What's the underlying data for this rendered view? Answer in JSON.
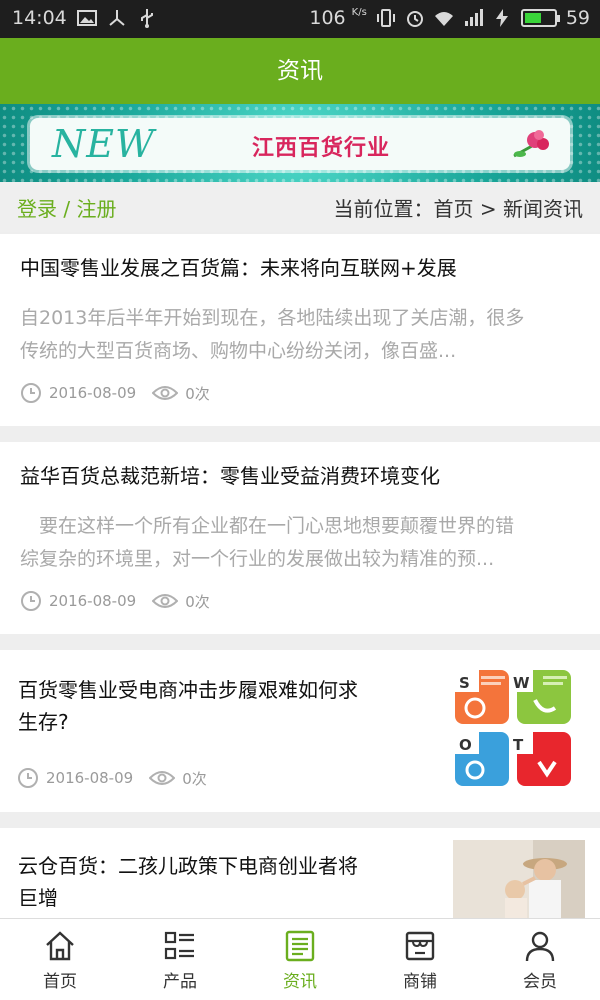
{
  "status_bar": {
    "time": "14:04",
    "net_speed": "106",
    "net_speed_unit": "K/s",
    "battery_level": "59"
  },
  "header": {
    "title": "资讯"
  },
  "banner": {
    "tag": "NEW",
    "title": "江西百货行业"
  },
  "breadcrumb_bar": {
    "login_link": "登录 / 注册",
    "location": "当前位置：首页 > 新闻资讯"
  },
  "articles": [
    {
      "title": "中国零售业发展之百货篇：未来将向互联网+发展",
      "summary_line1": "自2013年后半年开始到现在，各地陆续出现了关店潮，很多",
      "summary_line2": "传统的大型百货商场、购物中心纷纷关闭，像百盛...",
      "date": "2016-08-09",
      "views": "0次"
    },
    {
      "title": "益华百货总裁范新培：零售业受益消费环境变化",
      "summary_line1": "　要在这样一个所有企业都在一门心思地想要颠覆世界的错",
      "summary_line2": "综复杂的环境里，对一个行业的发展做出较为精准的预...",
      "date": "2016-08-09",
      "views": "0次"
    },
    {
      "title_line1": "百货零售业受电商冲击步履艰难如何求",
      "title_line2": "生存?",
      "date": "2016-08-09",
      "views": "0次",
      "thumb_letters": [
        "S",
        "W",
        "O",
        "T"
      ]
    },
    {
      "title_line1": "云仓百货：二孩儿政策下电商创业者将",
      "title_line2": "巨增"
    }
  ],
  "bottom_nav": [
    {
      "label": "首页",
      "icon": "home-icon"
    },
    {
      "label": "产品",
      "icon": "list-icon"
    },
    {
      "label": "资讯",
      "icon": "news-icon",
      "active": true
    },
    {
      "label": "商铺",
      "icon": "store-icon"
    },
    {
      "label": "会员",
      "icon": "user-icon"
    }
  ],
  "colors": {
    "brand_green": "#6aae1e",
    "status_bar": "#1e1e1e",
    "summary_gray": "#a9a9a9"
  }
}
